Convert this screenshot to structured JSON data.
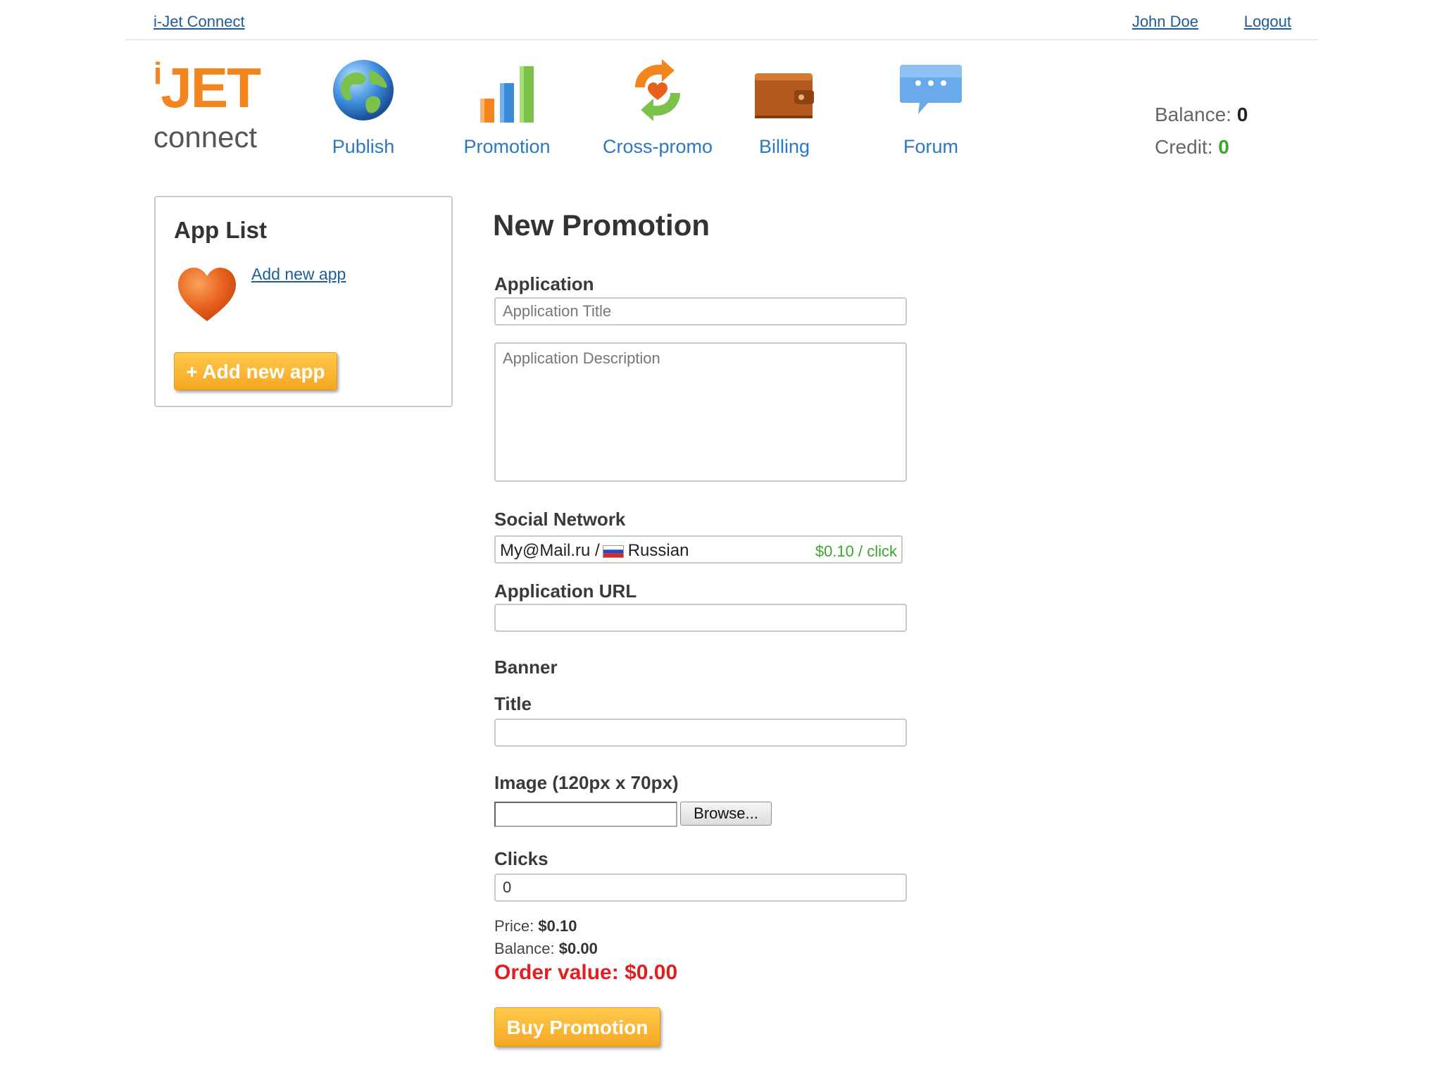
{
  "topbar": {
    "brand_link": "i-Jet Connect",
    "user_name": "John Doe",
    "logout": "Logout"
  },
  "logo": {
    "word": "JET",
    "prefix": "i",
    "sub": "connect"
  },
  "nav": [
    {
      "label": "Publish",
      "icon": "globe-icon"
    },
    {
      "label": "Promotion",
      "icon": "bar-chart-icon"
    },
    {
      "label": "Cross-promo",
      "icon": "cross-promo-icon"
    },
    {
      "label": "Billing",
      "icon": "wallet-icon"
    },
    {
      "label": "Forum",
      "icon": "chat-bubble-icon"
    }
  ],
  "account": {
    "balance_label": "Balance:",
    "balance_value": "0",
    "credit_label": "Credit:",
    "credit_value": "0"
  },
  "sidebar": {
    "title": "App List",
    "add_link": "Add new app",
    "add_button": "+ Add new app",
    "app_icon": "heart-icon"
  },
  "form": {
    "title": "New Promotion",
    "application_label": "Application",
    "app_title_placeholder": "Application Title",
    "app_desc_placeholder": "Application Description",
    "social_label": "Social Network",
    "social_network": "My@Mail.ru /",
    "social_language": "Russian",
    "social_price": "$0.10 / click",
    "url_label": "Application URL",
    "banner_label": "Banner",
    "banner_title_label": "Title",
    "image_label": "Image (120px x 70px)",
    "browse_button": "Browse...",
    "clicks_label": "Clicks",
    "clicks_value": "0",
    "price_label": "Price:",
    "price_value": "$0.10",
    "balance_label": "Balance:",
    "balance_value": "$0.00",
    "order_value": "Order value: $0.00",
    "buy_button": "Buy Promotion"
  },
  "colors": {
    "accent_orange": "#f5a622",
    "link_blue": "#1f5b99",
    "nav_blue": "#2a78c4",
    "credit_green": "#3aa72c",
    "order_red": "#e02020"
  }
}
